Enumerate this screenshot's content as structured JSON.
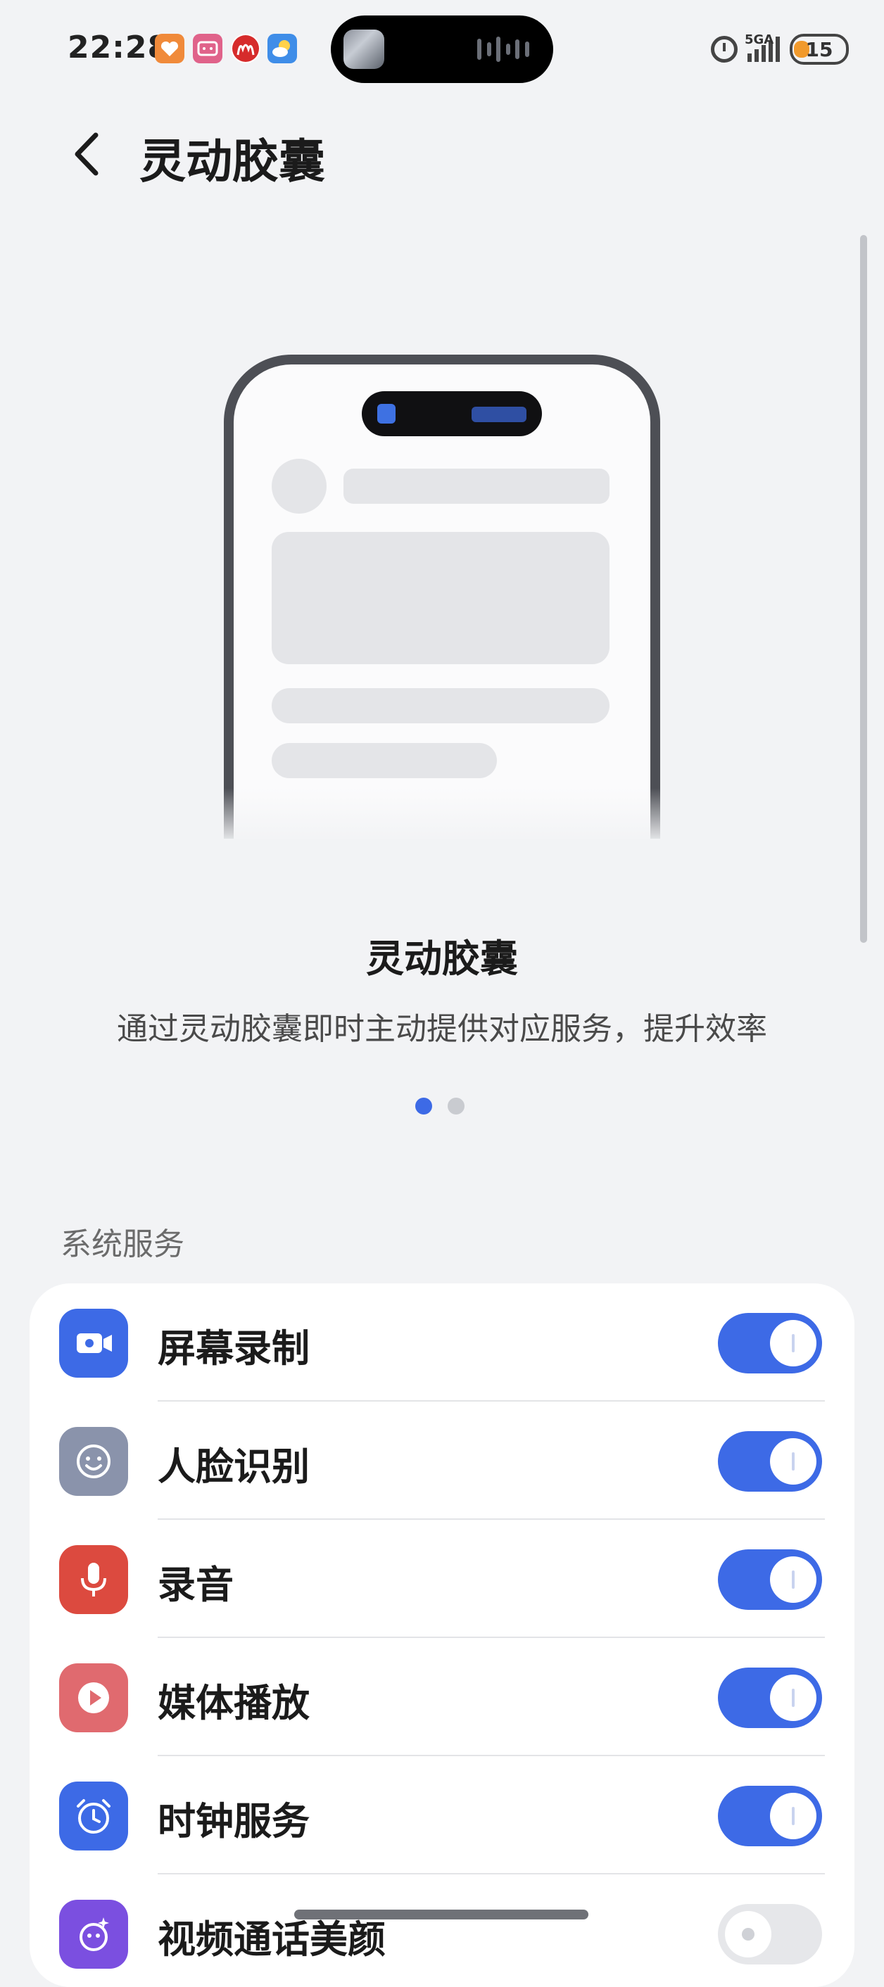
{
  "status_bar": {
    "time": "22:28",
    "app_icons": [
      {
        "name": "heart-app-icon",
        "color": "#f08a3a"
      },
      {
        "name": "bilibili-app-icon",
        "color": "#e0628a"
      },
      {
        "name": "mcdonalds-app-icon",
        "color": "#d62b2b"
      },
      {
        "name": "weather-app-icon",
        "color": "#3f8de8"
      }
    ],
    "network_label": "5GA",
    "battery_level": "15"
  },
  "header": {
    "title": "灵动胶囊"
  },
  "intro": {
    "title": "灵动胶囊",
    "description": "通过灵动胶囊即时主动提供对应服务，提升效率",
    "page_index": 0,
    "page_count": 2
  },
  "section": {
    "title": "系统服务"
  },
  "services": [
    {
      "label": "屏幕录制",
      "icon": "screen-record-icon",
      "icon_color": "#3d6ae6",
      "enabled": true
    },
    {
      "label": "人脸识别",
      "icon": "face-recognition-icon",
      "icon_color": "#8a93ab",
      "enabled": true
    },
    {
      "label": "录音",
      "icon": "microphone-icon",
      "icon_color": "#dc4a3f",
      "enabled": true
    },
    {
      "label": "媒体播放",
      "icon": "media-play-icon",
      "icon_color": "#e06a6f",
      "enabled": true
    },
    {
      "label": "时钟服务",
      "icon": "alarm-clock-icon",
      "icon_color": "#3d6ae6",
      "enabled": true
    },
    {
      "label": "视频通话美颜",
      "icon": "beauty-face-icon",
      "icon_color": "#7b4fe0",
      "enabled": false
    }
  ],
  "colors": {
    "accent": "#3d6ae6",
    "background": "#f2f3f5"
  }
}
